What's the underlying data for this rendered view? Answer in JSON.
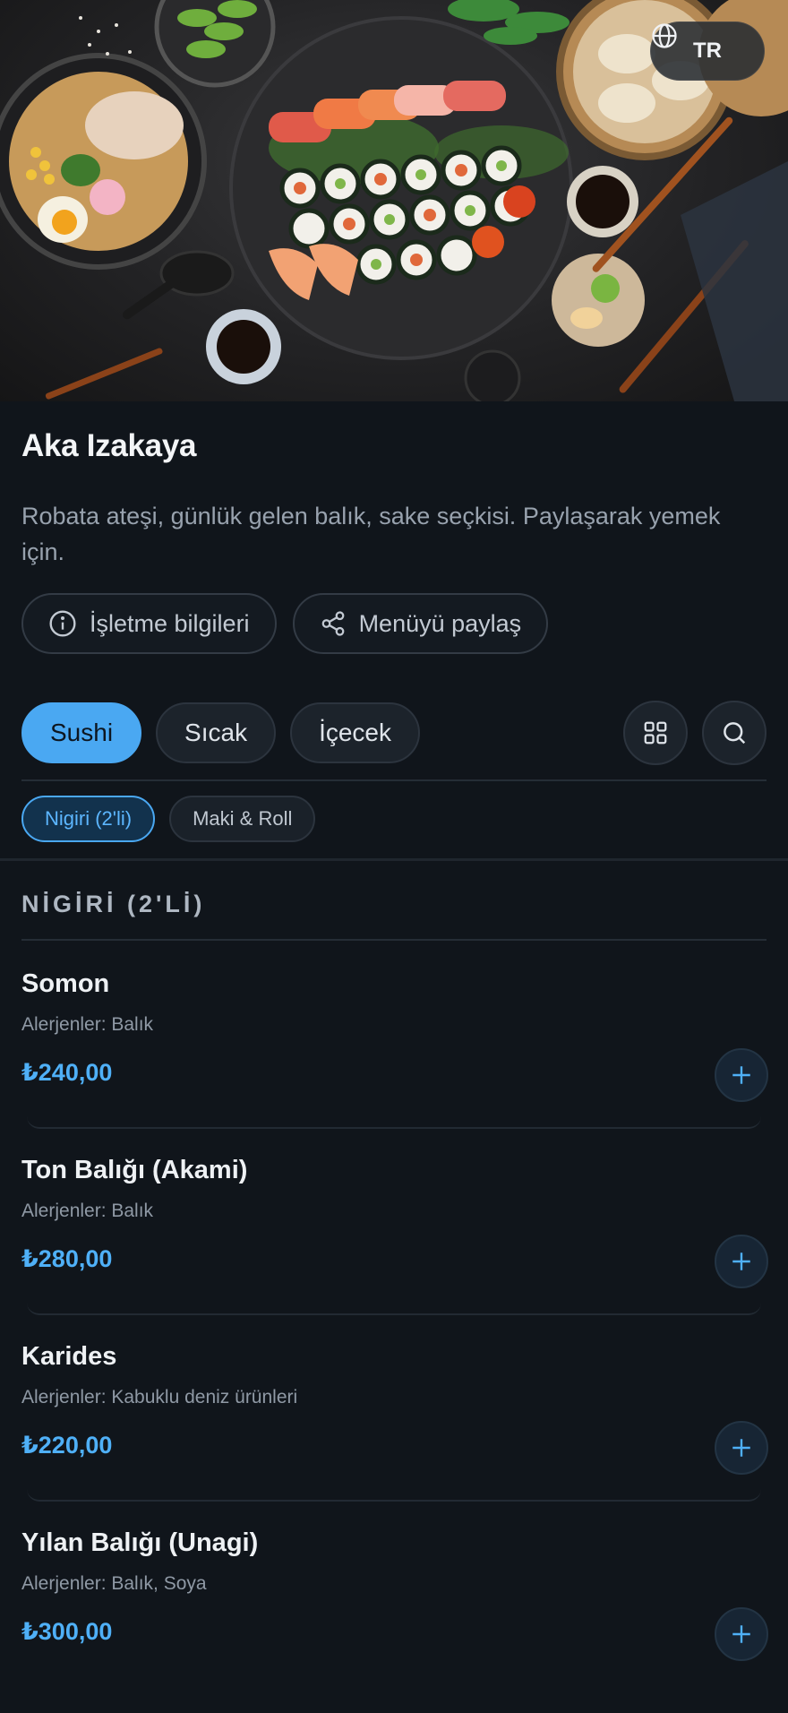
{
  "language": {
    "code": "TR",
    "icon": "globe-icon"
  },
  "restaurant": {
    "name": "Aka Izakaya",
    "description": "Robata ateşi, günlük gelen balık, sake seçkisi. Paylaşarak yemek için."
  },
  "actions": {
    "info_label": "İşletme bilgileri",
    "share_label": "Menüyü paylaş"
  },
  "categories": [
    {
      "label": "Sushi",
      "active": true
    },
    {
      "label": "Sıcak",
      "active": false
    },
    {
      "label": "İçecek",
      "active": false
    }
  ],
  "subcategories": [
    {
      "label": "Nigiri (2'li)",
      "active": true
    },
    {
      "label": "Maki & Roll",
      "active": false
    }
  ],
  "section": {
    "title": "NİGİRİ (2'Lİ)"
  },
  "items": [
    {
      "name": "Somon",
      "allergens": "Alerjenler: Balık",
      "price": "₺240,00"
    },
    {
      "name": "Ton Balığı (Akami)",
      "allergens": "Alerjenler: Balık",
      "price": "₺280,00"
    },
    {
      "name": "Karides",
      "allergens": "Alerjenler: Kabuklu deniz ürünleri",
      "price": "₺220,00"
    },
    {
      "name": "Yılan Balığı (Unagi)",
      "allergens": "Alerjenler: Balık, Soya",
      "price": "₺300,00"
    }
  ],
  "colors": {
    "accent": "#4aa8f2",
    "background": "#10151b",
    "price": "#4fb0f7"
  }
}
